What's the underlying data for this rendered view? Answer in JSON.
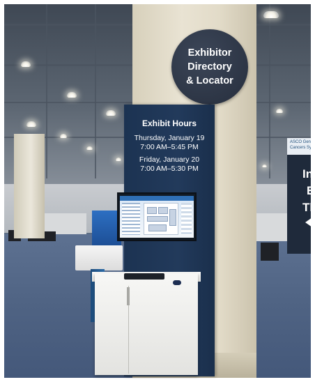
{
  "photo": {
    "description_free": true
  },
  "round_sign": {
    "line1": "Exhibitor",
    "line2": "Directory",
    "line3": "& Locator"
  },
  "kiosk": {
    "title": "Exhibit Hours",
    "day1_date": "Thursday, January 19",
    "day1_time": "7:00 AM–5:45 PM",
    "day2_date": "Friday, January 20",
    "day2_time": "7:00 AM–5:30 PM"
  },
  "right_sign": {
    "header_line1": "ASCO Gen",
    "header_line2": "Cancers Sym",
    "text_line1": "In",
    "text_line2": "E",
    "text_line3": "Th"
  },
  "colors": {
    "sign_navy": "#262e3d",
    "kiosk_navy": "#223a5b",
    "carpet_blue": "#4f6383"
  }
}
